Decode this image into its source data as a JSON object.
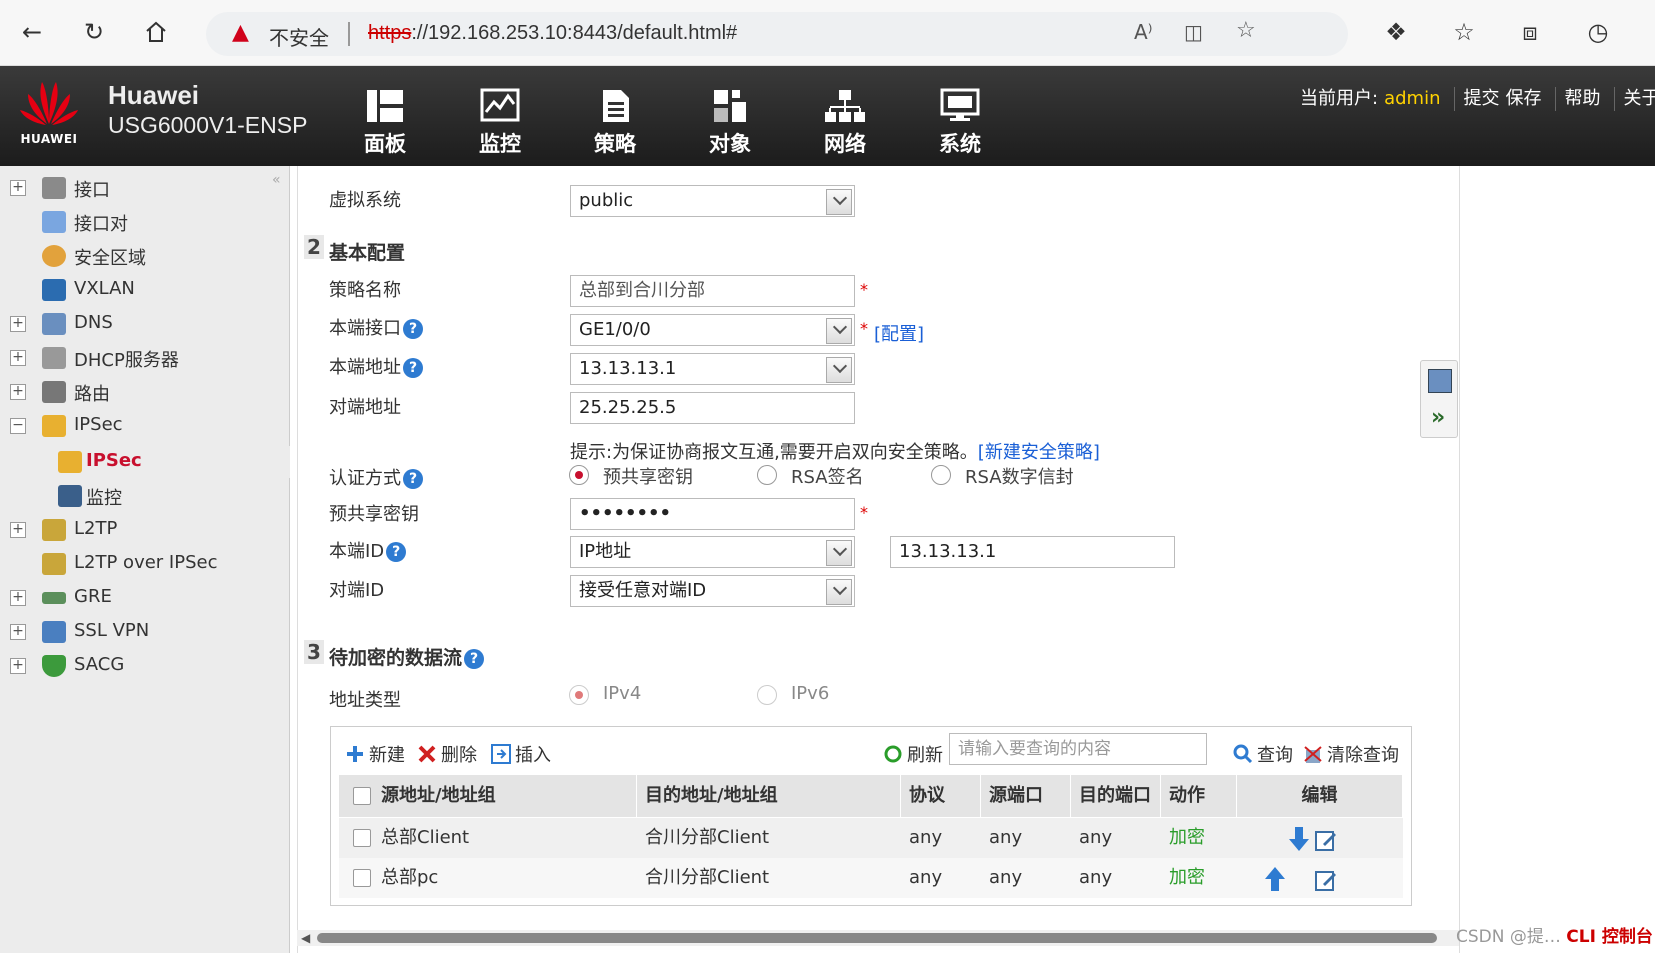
{
  "browser": {
    "insecure_label": "不安全",
    "url_scheme": "https",
    "url_rest": "://192.168.253.10:8443/default.html#"
  },
  "header": {
    "logo_text": "HUAWEI",
    "brand_title": "Huawei",
    "brand_model": "USG6000V1-ENSP",
    "nav": [
      {
        "label": "面板",
        "icon": "dashboard-icon"
      },
      {
        "label": "监控",
        "icon": "monitor-icon"
      },
      {
        "label": "策略",
        "icon": "policy-icon"
      },
      {
        "label": "对象",
        "icon": "object-icon"
      },
      {
        "label": "网络",
        "icon": "network-icon"
      },
      {
        "label": "系统",
        "icon": "system-icon"
      }
    ],
    "current_user_label": "当前用户:",
    "username": "admin",
    "actions": [
      "提交",
      "保存",
      "帮助",
      "关于"
    ]
  },
  "sidebar": {
    "items": [
      {
        "label": "接口",
        "expander": "+"
      },
      {
        "label": "接口对",
        "expander": ""
      },
      {
        "label": "安全区域",
        "expander": ""
      },
      {
        "label": "VXLAN",
        "expander": ""
      },
      {
        "label": "DNS",
        "expander": "+"
      },
      {
        "label": "DHCP服务器",
        "expander": "+"
      },
      {
        "label": "路由",
        "expander": "+"
      },
      {
        "label": "IPSec",
        "expander": "−"
      },
      {
        "label": "IPSec",
        "expander": ""
      },
      {
        "label": "监控",
        "expander": ""
      },
      {
        "label": "L2TP",
        "expander": "+"
      },
      {
        "label": "L2TP over IPSec",
        "expander": ""
      },
      {
        "label": "GRE",
        "expander": "+"
      },
      {
        "label": "SSL VPN",
        "expander": "+"
      },
      {
        "label": "SACG",
        "expander": "+"
      }
    ]
  },
  "form": {
    "vsys_label": "虚拟系统",
    "vsys_value": "public",
    "section2_num": "2",
    "section2_title": "基本配置",
    "policy_name_label": "策略名称",
    "policy_name_value": "总部到合川分部",
    "local_if_label": "本端接口",
    "local_if_value": "GE1/0/0",
    "config_link": "[配置]",
    "local_addr_label": "本端地址",
    "local_addr_value": "13.13.13.1",
    "peer_addr_label": "对端地址",
    "peer_addr_value": "25.25.25.5",
    "hint_text": "提示:为保证协商报文互通,需要开启双向安全策略。",
    "hint_link": "[新建安全策略]",
    "auth_label": "认证方式",
    "auth_options": [
      "预共享密钥",
      "RSA签名",
      "RSA数字信封"
    ],
    "auth_selected": "预共享密钥",
    "psk_label": "预共享密钥",
    "psk_value": "••••••••",
    "local_id_label": "本端ID",
    "local_id_type": "IP地址",
    "local_id_value": "13.13.13.1",
    "peer_id_label": "对端ID",
    "peer_id_value": "接受任意对端ID",
    "required_mark": "*",
    "section3_num": "3",
    "section3_title": "待加密的数据流",
    "addr_type_label": "地址类型",
    "addr_types": [
      "IPv4",
      "IPv6"
    ],
    "addr_type_selected": "IPv4"
  },
  "flow_table": {
    "toolbar": {
      "new": "新建",
      "delete": "删除",
      "insert": "插入",
      "refresh": "刷新",
      "search_placeholder": "请输入要查询的内容",
      "search": "查询",
      "clear": "清除查询"
    },
    "columns": [
      "源地址/地址组",
      "目的地址/地址组",
      "协议",
      "源端口",
      "目的端口",
      "动作",
      "编辑"
    ],
    "rows": [
      {
        "src": "总部Client",
        "dst": "合川分部Client",
        "proto": "any",
        "sport": "any",
        "dport": "any",
        "action": "加密"
      },
      {
        "src": "总部pc",
        "dst": "合川分部Client",
        "proto": "any",
        "sport": "any",
        "dport": "any",
        "action": "加密"
      }
    ]
  },
  "footer": {
    "watermark": "CSDN @提…",
    "cli_label": "CLI 控制台"
  }
}
